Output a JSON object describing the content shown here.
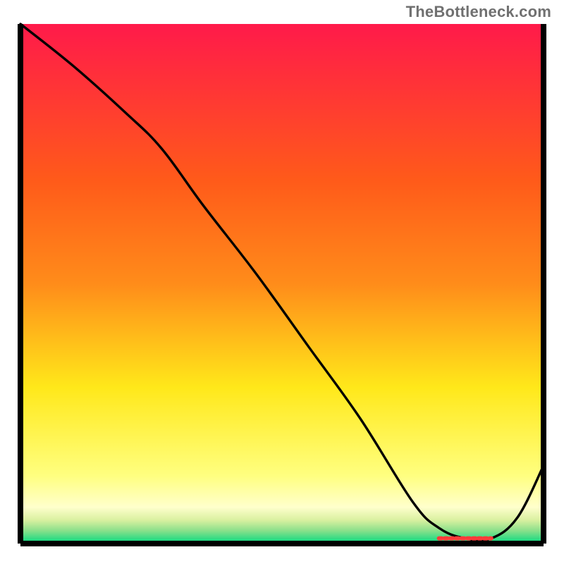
{
  "watermark": "TheBottleneck.com",
  "colors": {
    "gradient_top": "#ff1a4a",
    "gradient_mid_upper": "#ff8c1a",
    "gradient_mid": "#ffe81a",
    "gradient_lower": "#ffff80",
    "gradient_pale": "#ffffcc",
    "gradient_green_mid": "#8be08b",
    "gradient_green": "#00d980",
    "line": "#000000",
    "axis": "#000000",
    "marker": "#ff3a3a"
  },
  "chart_data": {
    "type": "line",
    "title": "",
    "xlabel": "",
    "ylabel": "",
    "xlim": [
      0,
      100
    ],
    "ylim": [
      0,
      100
    ],
    "grid": false,
    "legend": false,
    "series": [
      {
        "name": "curve",
        "x": [
          0,
          10,
          20,
          27,
          35,
          45,
          55,
          65,
          75,
          80,
          85,
          90,
          95,
          100
        ],
        "y": [
          100,
          92,
          83,
          76,
          65,
          52,
          38,
          24,
          8,
          3,
          1,
          1,
          5,
          15
        ]
      }
    ],
    "optimum_zone": {
      "x_start": 80,
      "x_end": 90,
      "y": 1
    }
  }
}
